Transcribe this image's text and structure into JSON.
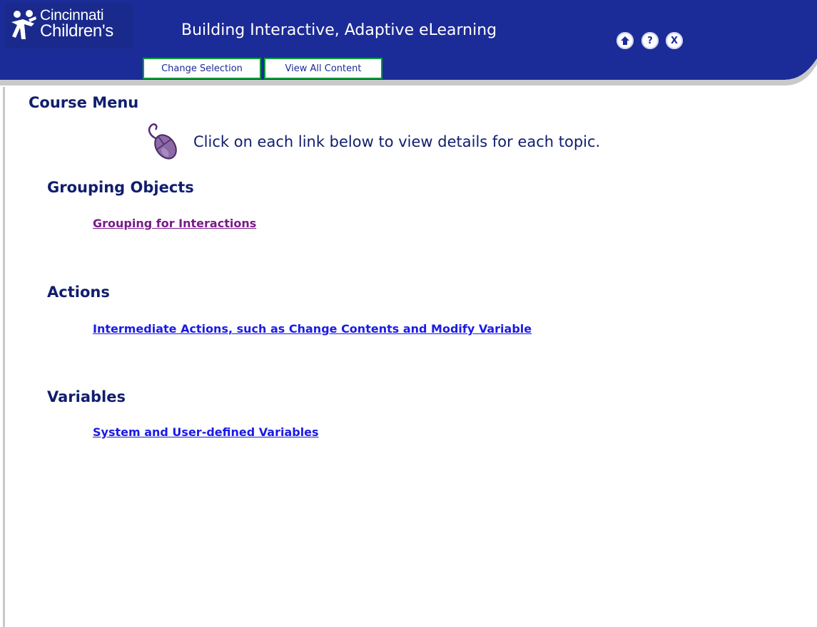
{
  "header": {
    "logo": {
      "line1": "Cincinnati",
      "line2": "Children's"
    },
    "title": "Building Interactive, Adaptive eLearning",
    "icons": {
      "home": "home-icon",
      "help": "?",
      "close": "X"
    },
    "tabs": [
      {
        "label": "Change Selection"
      },
      {
        "label": "View All Content"
      }
    ],
    "colors": {
      "bar": "#1b2b97",
      "tab_border": "#0a9a3c"
    }
  },
  "main": {
    "heading": "Course Menu",
    "instruction": "Click on each link below to view details for each topic.",
    "sections": [
      {
        "title": "Grouping Objects",
        "link": "Grouping for Interactions",
        "visited": true
      },
      {
        "title": "Actions",
        "link": "Intermediate Actions, such as Change Contents and Modify Variable",
        "visited": false
      },
      {
        "title": "Variables",
        "link": "System and User-defined Variables",
        "visited": false
      }
    ]
  }
}
